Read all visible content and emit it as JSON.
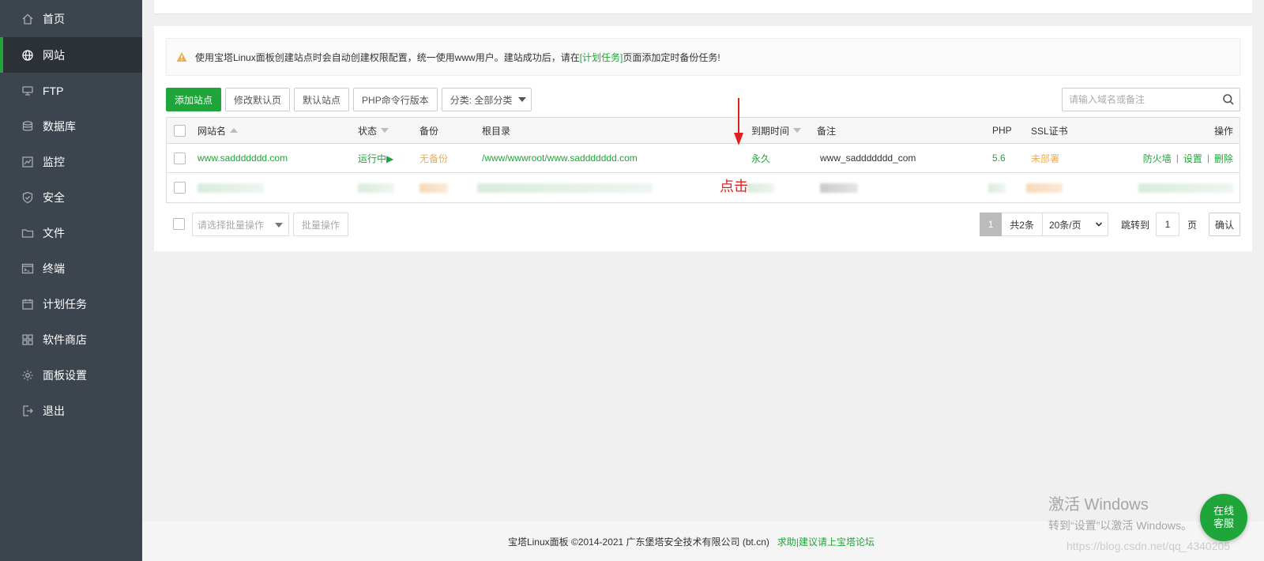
{
  "sidebar": {
    "items": [
      {
        "label": "首页",
        "icon": "home-icon",
        "active": false
      },
      {
        "label": "网站",
        "icon": "globe-icon",
        "active": true
      },
      {
        "label": "FTP",
        "icon": "ftp-icon",
        "active": false
      },
      {
        "label": "数据库",
        "icon": "database-icon",
        "active": false
      },
      {
        "label": "监控",
        "icon": "monitor-icon",
        "active": false
      },
      {
        "label": "安全",
        "icon": "shield-icon",
        "active": false
      },
      {
        "label": "文件",
        "icon": "folder-icon",
        "active": false
      },
      {
        "label": "终端",
        "icon": "terminal-icon",
        "active": false
      },
      {
        "label": "计划任务",
        "icon": "calendar-icon",
        "active": false
      },
      {
        "label": "软件商店",
        "icon": "apps-icon",
        "active": false
      },
      {
        "label": "面板设置",
        "icon": "gear-icon",
        "active": false
      },
      {
        "label": "退出",
        "icon": "logout-icon",
        "active": false
      }
    ]
  },
  "alert": {
    "text_before": "使用宝塔Linux面板创建站点时会自动创建权限配置，统一使用www用户。建站成功后，请在",
    "link": "[计划任务]",
    "text_after": "页面添加定时备份任务!"
  },
  "toolbar": {
    "add_site": "添加站点",
    "edit_default_page": "修改默认页",
    "default_site": "默认站点",
    "php_cli_version": "PHP命令行版本",
    "category": "分类: 全部分类"
  },
  "search": {
    "placeholder": "请输入域名或备注"
  },
  "table": {
    "headers": {
      "site_name": "网站名",
      "status": "状态",
      "backup": "备份",
      "root_dir": "根目录",
      "expire": "到期时间",
      "note": "备注",
      "php": "PHP",
      "ssl": "SSL证书",
      "ops": "操作"
    },
    "rows": [
      {
        "site_name": "www.saddddddd.com",
        "status": "运行中▶",
        "backup": "无备份",
        "root_dir": "/www/wwwroot/www.saddddddd.com",
        "expire": "永久",
        "note": "www_saddddddd_com",
        "php": "5.6",
        "ssl": "未部署",
        "ops": {
          "firewall": "防火墙",
          "settings": "设置",
          "delete": "删除",
          "sep": "|"
        }
      }
    ]
  },
  "batch": {
    "select_placeholder": "请选择批量操作",
    "button": "批量操作"
  },
  "pager": {
    "current": "1",
    "total": "共2条",
    "per_page": "20条/页",
    "jump_label": "跳转到",
    "jump_value": "1",
    "page_label": "页",
    "confirm": "确认"
  },
  "annotation": {
    "text": "点击"
  },
  "footer": {
    "copyright": "宝塔Linux面板 ©2014-2021 广东堡塔安全技术有限公司 (bt.cn)",
    "link": "求助|建议请上宝塔论坛"
  },
  "watermark": {
    "line1": "激活 Windows",
    "line2": "转到“设置”以激活 Windows。",
    "csdn": "https://blog.csdn.net/qq_4340205"
  },
  "service": {
    "line1": "在线",
    "line2": "客服"
  },
  "colors": {
    "accent": "#20a53a",
    "sidebar": "#3c444d",
    "warning": "#f0ad4e",
    "annotation": "#e02020"
  }
}
